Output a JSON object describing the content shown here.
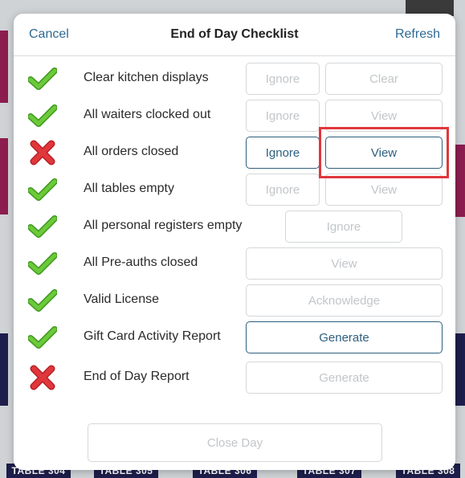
{
  "background": {
    "table_labels": [
      "TABLE 304",
      "TABLE 305",
      "TABLE 306",
      "TABLE 307",
      "TABLE 308"
    ]
  },
  "modal": {
    "cancel_label": "Cancel",
    "title": "End of Day Checklist",
    "refresh_label": "Refresh",
    "close_day_label": "Close Day"
  },
  "checklist": [
    {
      "label": "Clear kitchen displays",
      "status": "done",
      "buttons": [
        "Ignore",
        "Clear"
      ]
    },
    {
      "label": "All waiters clocked out",
      "status": "done",
      "buttons": [
        "Ignore",
        "View"
      ]
    },
    {
      "label": "All orders closed",
      "status": "failed",
      "buttons": [
        "Ignore",
        "View"
      ]
    },
    {
      "label": "All tables empty",
      "status": "done",
      "buttons": [
        "Ignore",
        "View"
      ]
    },
    {
      "label": "All personal registers empty",
      "status": "done",
      "buttons": [
        "Ignore"
      ]
    },
    {
      "label": "All Pre-auths closed",
      "status": "done",
      "buttons": [
        "View"
      ]
    },
    {
      "label": "Valid License",
      "status": "done",
      "buttons": [
        "Acknowledge"
      ]
    },
    {
      "label": "Gift Card Activity Report",
      "status": "done",
      "buttons": [
        "Generate"
      ]
    },
    {
      "label": "End of Day Report",
      "status": "failed",
      "buttons": [
        "Generate"
      ]
    }
  ],
  "colors": {
    "link_blue": "#2e6a93",
    "active_button": "#2e5f7e",
    "disabled_text": "#c2c6c9",
    "check_green": "#5cb82f",
    "cross_red": "#e0373d",
    "highlight_red": "#e0373d"
  }
}
